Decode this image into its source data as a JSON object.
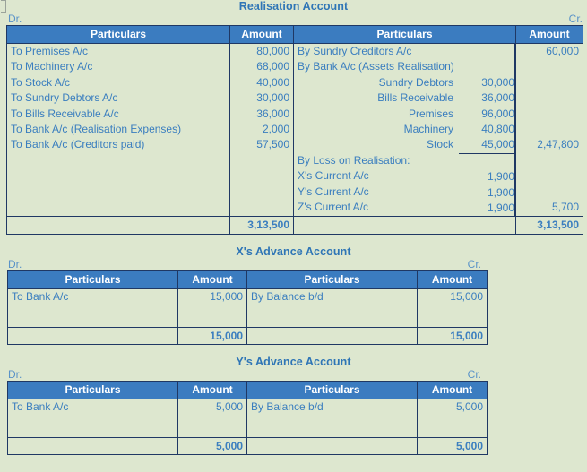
{
  "page": {
    "background_color": "#dde7cf",
    "header_color": "#3b7cc0",
    "text_color": "#3a7ebf",
    "title_color": "#2e75b6",
    "border_color": "#1f3864"
  },
  "labels": {
    "dr": "Dr.",
    "cr": "Cr.",
    "particulars": "Particulars",
    "amount": "Amount"
  },
  "accounts": [
    {
      "title": "Realisation Account",
      "debit": {
        "lines": [
          {
            "particulars": "To Premises A/c",
            "amount": "80,000"
          },
          {
            "particulars": "To Machinery A/c",
            "amount": "68,000"
          },
          {
            "particulars": "To Stock A/c",
            "amount": "40,000"
          },
          {
            "particulars": "To Sundry Debtors A/c",
            "amount": "30,000"
          },
          {
            "particulars": "To Bills Receivable A/c",
            "amount": "36,000"
          },
          {
            "particulars": "To Bank A/c (Realisation Expenses)",
            "amount": "2,000"
          },
          {
            "particulars": "To Bank A/c (Creditors paid)",
            "amount": "57,500"
          }
        ],
        "total": "3,13,500"
      },
      "credit": {
        "lines": [
          {
            "particulars": "By Sundry Creditors A/c",
            "sub_label": "",
            "sub_amount": "",
            "amount": "60,000"
          },
          {
            "particulars": "By Bank A/c (Assets Realisation)",
            "sub_label": "",
            "sub_amount": "",
            "amount": ""
          },
          {
            "particulars": "",
            "sub_label": "Sundry Debtors",
            "sub_amount": "30,000",
            "amount": ""
          },
          {
            "particulars": "",
            "sub_label": "Bills Receivable",
            "sub_amount": "36,000",
            "amount": ""
          },
          {
            "particulars": "",
            "sub_label": "Premises",
            "sub_amount": "96,000",
            "amount": ""
          },
          {
            "particulars": "",
            "sub_label": "Machinery",
            "sub_amount": "40,800",
            "amount": ""
          },
          {
            "particulars": "",
            "sub_label": "Stock",
            "sub_amount": "45,000",
            "amount": "2,47,800",
            "rule_after_sub": true
          },
          {
            "particulars": "By Loss on Realisation:",
            "sub_label": "",
            "sub_amount": "",
            "amount": ""
          },
          {
            "particulars": "X's Current A/c",
            "sub_label": "",
            "sub_amount": "1,900",
            "amount": ""
          },
          {
            "particulars": "Y's Current A/c",
            "sub_label": "",
            "sub_amount": "1,900",
            "amount": ""
          },
          {
            "particulars": "Z's Current A/c",
            "sub_label": "",
            "sub_amount": "1,900",
            "amount": "5,700"
          }
        ],
        "total": "3,13,500"
      }
    },
    {
      "title": "X's Advance Account",
      "debit": {
        "lines": [
          {
            "particulars": "To Bank A/c",
            "amount": "15,000"
          }
        ],
        "total": "15,000"
      },
      "credit": {
        "lines": [
          {
            "particulars": "By Balance b/d",
            "amount": "15,000"
          }
        ],
        "total": "15,000"
      }
    },
    {
      "title": "Y's Advance Account",
      "debit": {
        "lines": [
          {
            "particulars": "To Bank A/c",
            "amount": "5,000"
          }
        ],
        "total": "5,000"
      },
      "credit": {
        "lines": [
          {
            "particulars": "By Balance b/d",
            "amount": "5,000"
          }
        ],
        "total": "5,000"
      }
    }
  ]
}
